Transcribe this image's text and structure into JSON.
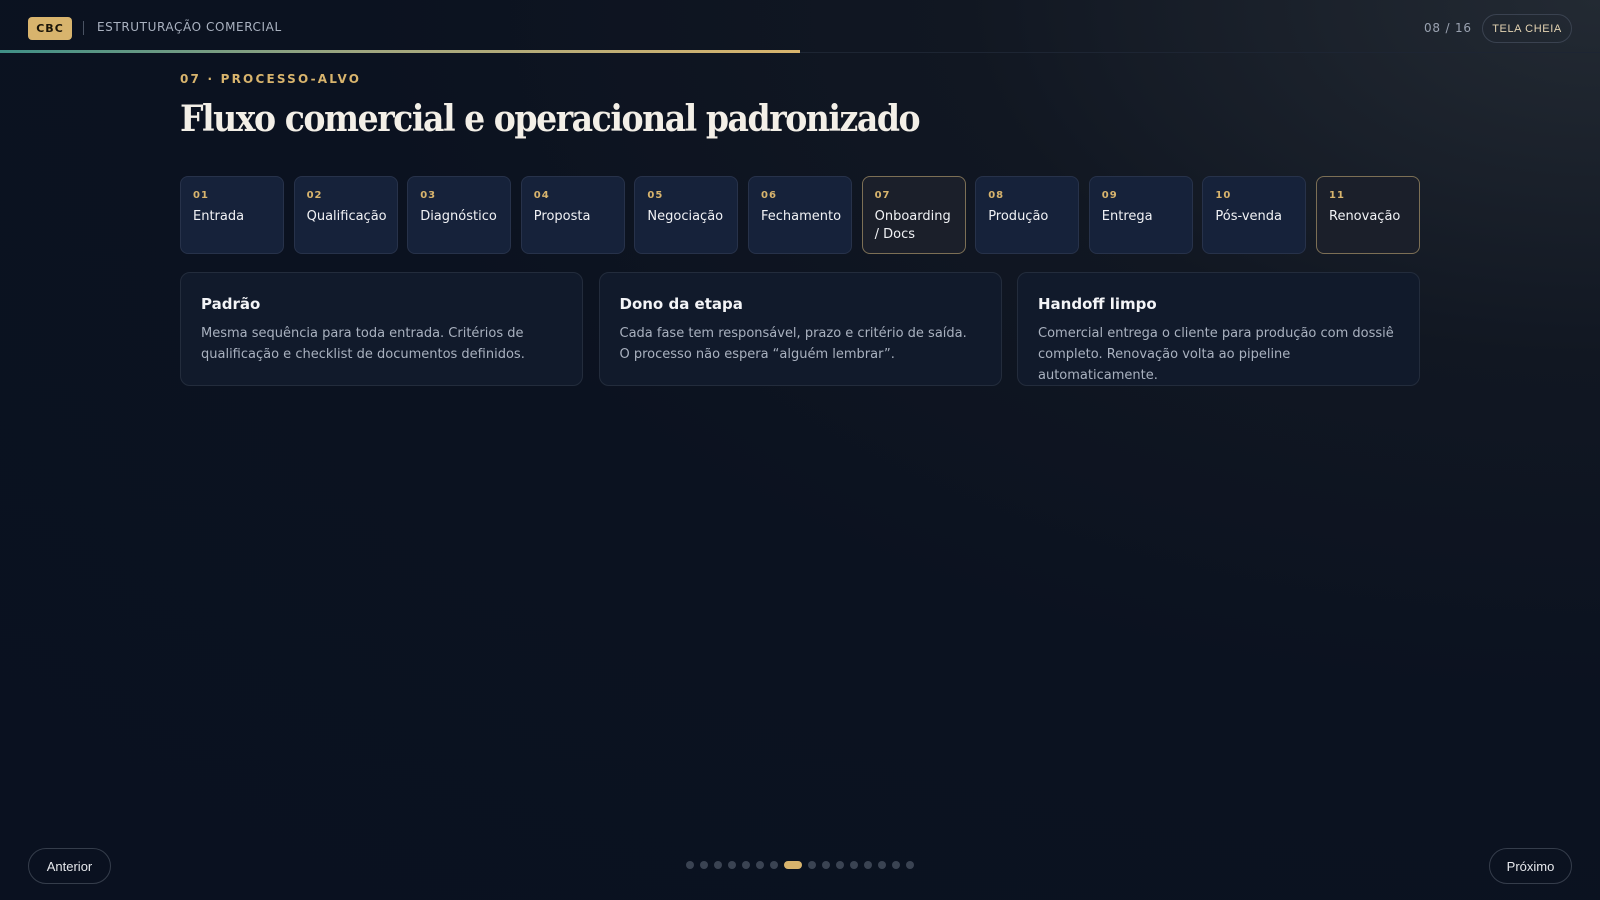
{
  "header": {
    "brand_badge": "CBC",
    "brand_title": "ESTRUTURAÇÃO COMERCIAL",
    "page_counter": "08 / 16",
    "fullscreen_label": "TELA CHEIA"
  },
  "progress": {
    "fraction": 0.5
  },
  "slide": {
    "eyebrow": "07 · PROCESSO-ALVO",
    "title": "Fluxo comercial e operacional padronizado",
    "steps": [
      {
        "num": "01",
        "label": "Entrada",
        "highlight": false
      },
      {
        "num": "02",
        "label": "Qualificação",
        "highlight": false
      },
      {
        "num": "03",
        "label": "Diagnóstico",
        "highlight": false
      },
      {
        "num": "04",
        "label": "Proposta",
        "highlight": false
      },
      {
        "num": "05",
        "label": "Negociação",
        "highlight": false
      },
      {
        "num": "06",
        "label": "Fechamento",
        "highlight": false
      },
      {
        "num": "07",
        "label": "Onboarding / Docs",
        "highlight": true
      },
      {
        "num": "08",
        "label": "Produção",
        "highlight": false
      },
      {
        "num": "09",
        "label": "Entrega",
        "highlight": false
      },
      {
        "num": "10",
        "label": "Pós-venda",
        "highlight": false
      },
      {
        "num": "11",
        "label": "Renovação",
        "highlight": true
      }
    ],
    "cards": [
      {
        "title": "Padrão",
        "body": "Mesma sequência para toda entrada. Critérios de qualificação e checklist de documentos definidos."
      },
      {
        "title": "Dono da etapa",
        "body": "Cada fase tem responsável, prazo e critério de saída. O processo não espera “alguém lembrar”."
      },
      {
        "title": "Handoff limpo",
        "body": "Comercial entrega o cliente para produção com dossiê completo. Renovação volta ao pipeline automaticamente."
      }
    ]
  },
  "footer": {
    "prev_label": "Anterior",
    "next_label": "Próximo",
    "total_slides": 16,
    "active_slide_index": 7
  },
  "colors": {
    "accent": "#d8b46d",
    "background": "#0b1220",
    "step_bg": "#16223a",
    "card_bg": "#111a2b",
    "progress_start": "#3f8f86"
  }
}
